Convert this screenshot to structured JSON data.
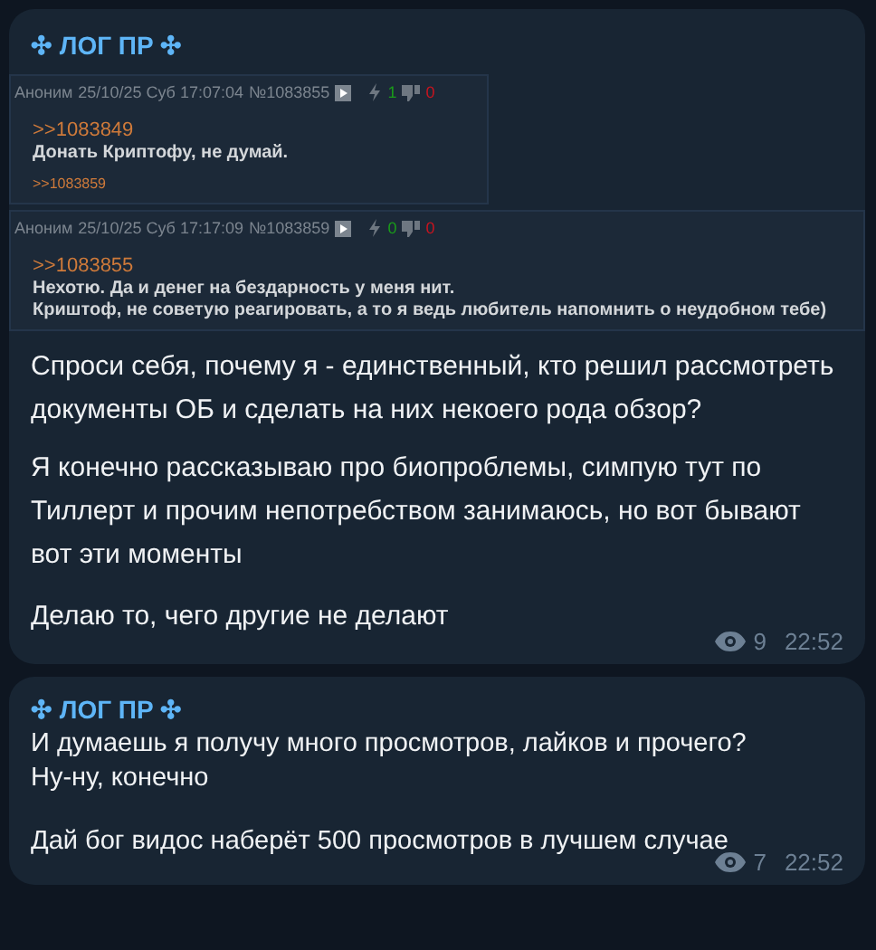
{
  "messages": [
    {
      "sender": "✣ ЛОГ ПР ✣",
      "screenshot": {
        "posts": [
          {
            "author": "Аноним",
            "date": "25/10/25 Суб 17:07:04",
            "number": "№1083855",
            "likes": "1",
            "dislikes": "0",
            "wide": false,
            "reply_ref": ">>1083849",
            "lines": [
              "Донать Криптофу, не думай."
            ],
            "backlinks": [
              ">>1083859"
            ]
          },
          {
            "author": "Аноним",
            "date": "25/10/25 Суб 17:17:09",
            "number": "№1083859",
            "likes": "0",
            "dislikes": "0",
            "wide": true,
            "reply_ref": ">>1083855",
            "lines": [
              "Нехотю. Да и денег на бездарность у меня нит.",
              "Криштоф, не советую реагировать, а то я ведь любитель напомнить о неудобном тебе)"
            ]
          }
        ]
      },
      "paragraphs": [
        "Спроси себя, почему я - единственный, кто решил рассмотреть документы ОБ и сделать на них некоего рода обзор?",
        "Я конечно рассказываю про биопроблемы, симпую тут по Тиллерт и прочим непотребством занимаюсь, но вот бывают вот эти моменты",
        "Делаю то, чего другие не делают"
      ],
      "views": "9",
      "time": "22:52"
    },
    {
      "sender": "✣ ЛОГ ПР ✣",
      "paragraphs": [
        "И думаешь я получу много просмотров, лайков и прочего?\nНу-ну, конечно",
        "Дай бог видос наберёт 500 просмотров в лучшем случае"
      ],
      "views": "7",
      "time": "22:52"
    }
  ]
}
